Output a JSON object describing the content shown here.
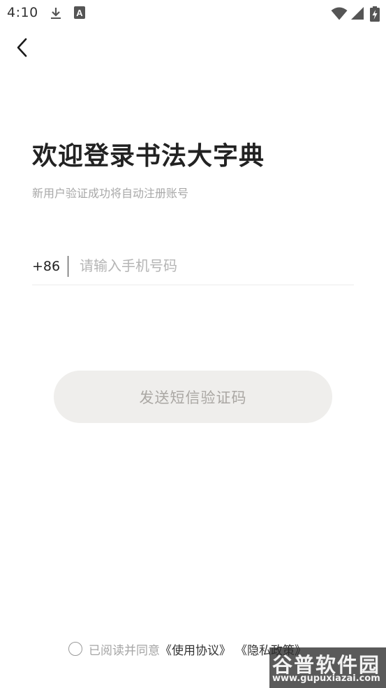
{
  "status_bar": {
    "time": "4:10",
    "icons": [
      "download-icon",
      "a-badge-icon",
      "wifi-icon",
      "signal-icon",
      "battery-icon"
    ],
    "a_badge_letter": "A"
  },
  "nav": {
    "back_icon": "chevron-left-icon"
  },
  "welcome": {
    "title": "欢迎登录书法大字典",
    "subtitle": "新用户验证成功将自动注册账号"
  },
  "phone": {
    "country_code": "+86",
    "value": "",
    "placeholder": "请输入手机号码"
  },
  "send_code": {
    "label": "发送短信验证码"
  },
  "agreement": {
    "checked": false,
    "prefix": "已阅读并同意",
    "terms_link": "《使用协议》",
    "privacy_link": "《隐私政策》"
  },
  "watermark": {
    "logo_text": "谷普软件园",
    "url": "www.gupuxiazai.com"
  },
  "colors": {
    "text": "#222222",
    "muted": "#a8a8a8",
    "button_bg": "#efeeec",
    "button_text": "#aaa7a3"
  }
}
